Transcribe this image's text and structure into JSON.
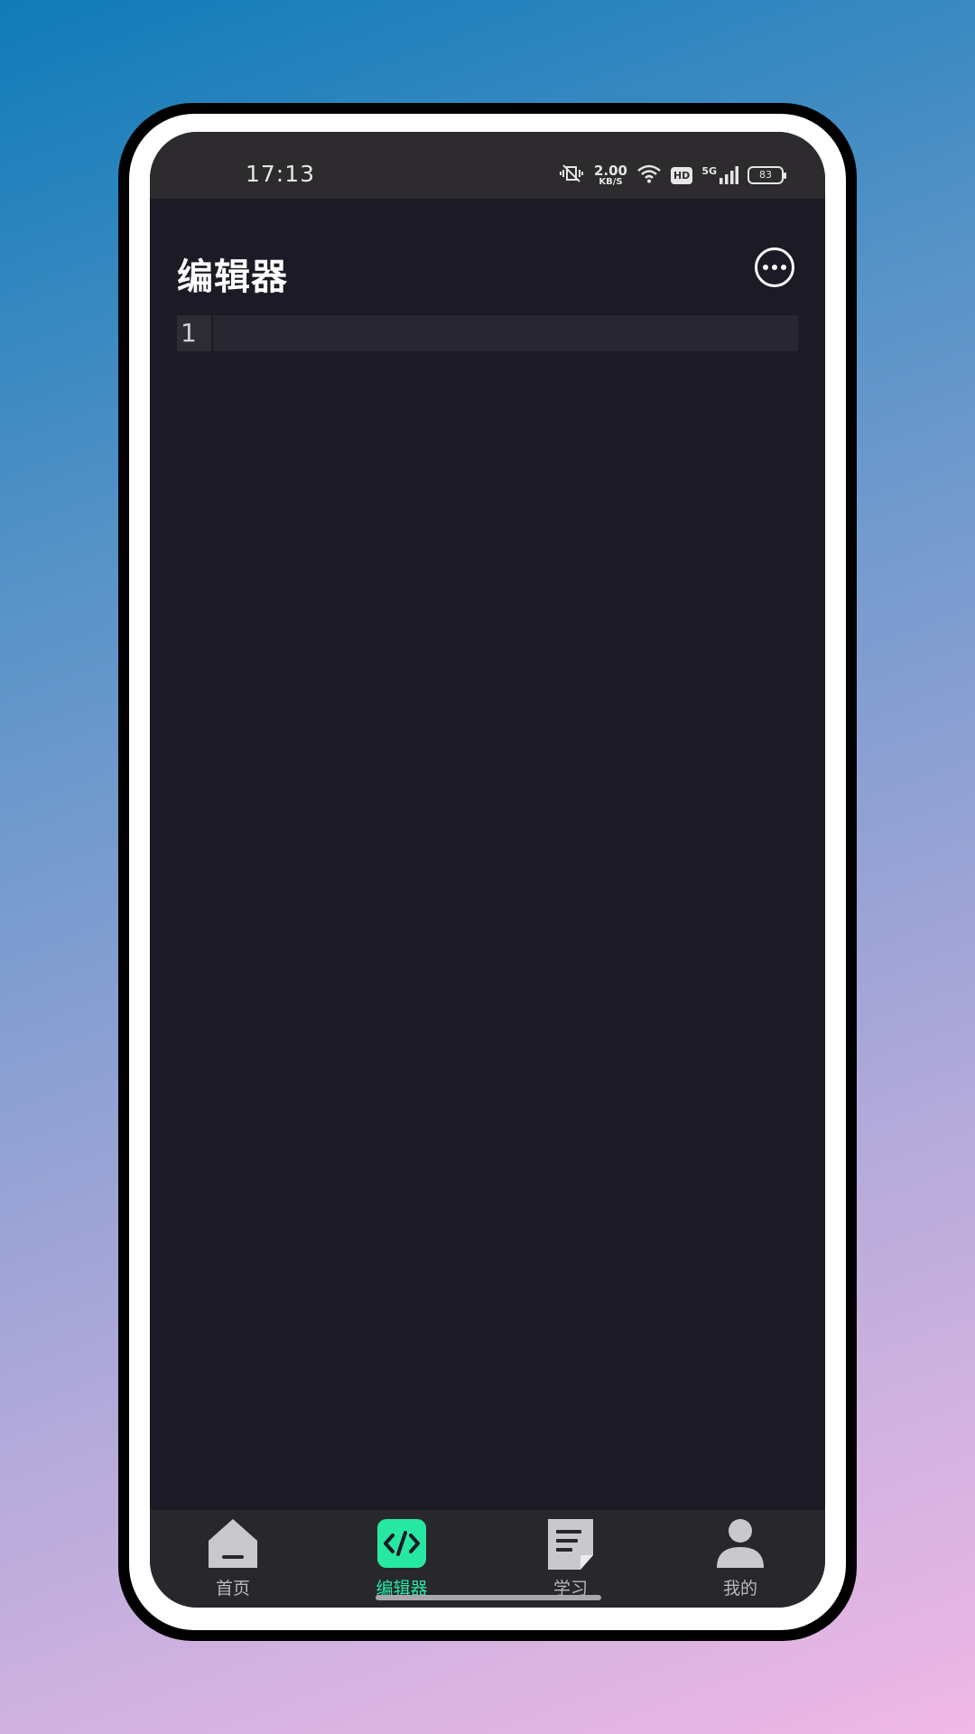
{
  "status_bar": {
    "time": "17:13",
    "speed_value": "2.00",
    "speed_unit": "KB/S",
    "hd_label": "HD",
    "network": "5G",
    "battery": "83",
    "icons": [
      "vibrate-icon",
      "wifi-icon",
      "hd-icon",
      "signal-icon",
      "battery-icon"
    ]
  },
  "header": {
    "title": "编辑器",
    "more_icon": "more-icon"
  },
  "editor": {
    "lines": [
      {
        "number": "1",
        "text": ""
      }
    ]
  },
  "tabbar": {
    "tabs": [
      {
        "label": "首页",
        "icon": "home-icon",
        "active": false
      },
      {
        "label": "编辑器",
        "icon": "code-icon",
        "active": true
      },
      {
        "label": "学习",
        "icon": "document-icon",
        "active": false
      },
      {
        "label": "我的",
        "icon": "user-icon",
        "active": false
      }
    ]
  },
  "colors": {
    "accent": "#27e8a3",
    "background": "#1b1a25",
    "status_bar": "#2d2b2e",
    "tabbar": "#28272c"
  }
}
